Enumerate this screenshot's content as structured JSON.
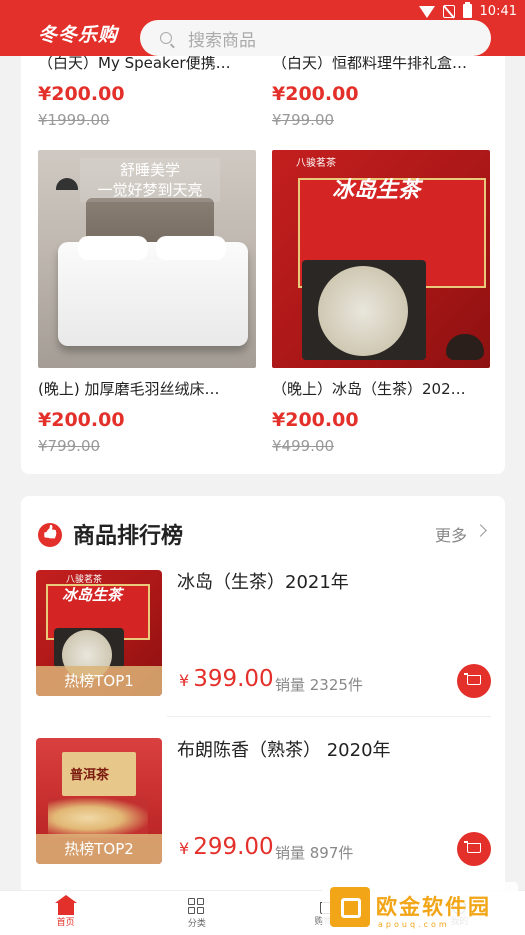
{
  "status_bar": {
    "time": "10:41"
  },
  "header": {
    "app_name": "冬冬乐购",
    "search_placeholder": "搜索商品"
  },
  "products": [
    {
      "name": "（白天）My Speaker便携…",
      "price": "¥200.00",
      "old_price": "¥1999.00"
    },
    {
      "name": "（白天）恒都料理牛排礼盒…",
      "price": "¥200.00",
      "old_price": "¥799.00"
    },
    {
      "name": "(晚上) 加厚磨毛羽丝绒床…",
      "price": "¥200.00",
      "old_price": "¥799.00",
      "image_caption": "舒睡美学\n一觉好梦到天亮"
    },
    {
      "name": "（晚上）冰岛（生茶）202…",
      "price": "¥200.00",
      "old_price": "¥499.00",
      "image_caption": "冰岛生茶",
      "image_brand": "八骏茗茶"
    }
  ],
  "ranking": {
    "title": "商品排行榜",
    "more_label": "更多",
    "items": [
      {
        "name": "冰岛（生茶）2021年",
        "price": "399.00",
        "currency": "¥",
        "sales": "销量 2325件",
        "badge": "热榜TOP1",
        "image_caption": "冰岛生茶",
        "image_brand": "八骏茗茶"
      },
      {
        "name": "布朗陈香（熟茶） 2020年",
        "price": "299.00",
        "currency": "¥",
        "sales": "销量 897件",
        "badge": "热榜TOP2",
        "image_caption": "普洱茶"
      }
    ]
  },
  "bottom_nav": [
    {
      "label": "首页",
      "icon": "home-icon",
      "active": true
    },
    {
      "label": "分类",
      "icon": "category-icon",
      "active": false
    },
    {
      "label": "购物车",
      "icon": "cart-icon",
      "active": false
    },
    {
      "label": "我的",
      "icon": "user-icon",
      "active": false
    }
  ],
  "watermark": {
    "text": "欧金软件园",
    "sub": "apouq.com"
  },
  "colors": {
    "brand_red": "#e4302a",
    "price_red": "#e4302a",
    "watermark_orange": "#f2a516"
  }
}
